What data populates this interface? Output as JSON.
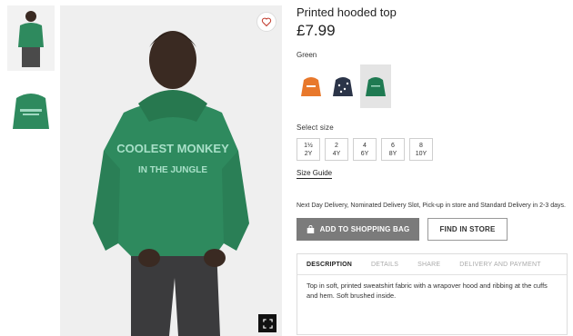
{
  "product": {
    "title": "Printed hooded top",
    "price": "£7.99",
    "hoodie_print": [
      "COOLEST MONKEY",
      "IN THE JUNGLE"
    ]
  },
  "color": {
    "selected_label": "Green",
    "swatches": [
      {
        "name": "orange",
        "hex": "#e8782b"
      },
      {
        "name": "navy",
        "hex": "#2b3448"
      },
      {
        "name": "green",
        "hex": "#1f7a52"
      }
    ]
  },
  "sizes": {
    "label": "Select size",
    "options": [
      {
        "top": "1½",
        "bottom": "2Y"
      },
      {
        "top": "2",
        "bottom": "4Y"
      },
      {
        "top": "4",
        "bottom": "6Y"
      },
      {
        "top": "6",
        "bottom": "8Y"
      },
      {
        "top": "8",
        "bottom": "10Y"
      }
    ],
    "guide_label": "Size Guide"
  },
  "delivery_text": "Next Day Delivery, Nominated Delivery Slot, Pick-up in store and Standard Delivery in 2-3 days.",
  "buttons": {
    "add_to_bag": "ADD TO SHOPPING BAG",
    "find_in_store": "FIND IN STORE"
  },
  "tabs": {
    "items": [
      "DESCRIPTION",
      "DETAILS",
      "SHARE",
      "DELIVERY AND PAYMENT"
    ],
    "active": "DESCRIPTION",
    "description": "Top in soft, printed sweatshirt fabric with a wrapover hood and ribbing at the cuffs and hem. Soft brushed inside."
  },
  "colors": {
    "hoodie_green": "#2e8a5e",
    "button_grey": "#7b7b7b"
  }
}
